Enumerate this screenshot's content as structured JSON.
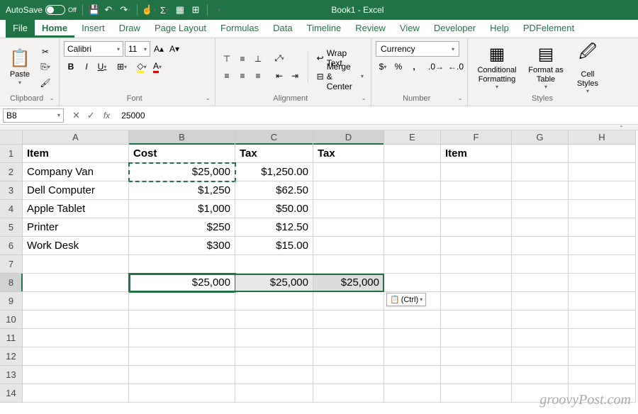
{
  "titlebar": {
    "autosave_label": "AutoSave",
    "autosave_state": "Off",
    "title": "Book1 - Excel"
  },
  "tabs": [
    "File",
    "Home",
    "Insert",
    "Draw",
    "Page Layout",
    "Formulas",
    "Data",
    "Timeline",
    "Review",
    "View",
    "Developer",
    "Help",
    "PDFelement"
  ],
  "ribbon": {
    "clipboard": {
      "paste": "Paste",
      "label": "Clipboard"
    },
    "font": {
      "name": "Calibri",
      "size": "11",
      "bold": "B",
      "italic": "I",
      "underline": "U",
      "label": "Font"
    },
    "alignment": {
      "wrap": "Wrap Text",
      "merge": "Merge & Center",
      "label": "Alignment"
    },
    "number": {
      "format": "Currency",
      "label": "Number"
    },
    "styles": {
      "cond": "Conditional Formatting",
      "fmt_table": "Format as Table",
      "cell": "Cell Styles",
      "label": "Styles"
    }
  },
  "formula_bar": {
    "name_box": "B8",
    "fx": "fx",
    "value": "25000"
  },
  "columns": [
    "A",
    "B",
    "C",
    "D",
    "E",
    "F",
    "G",
    "H"
  ],
  "rows": [
    "1",
    "2",
    "3",
    "4",
    "5",
    "6",
    "7",
    "8",
    "9",
    "10",
    "11",
    "12",
    "13",
    "14"
  ],
  "data": {
    "headers": {
      "A1": "Item",
      "B1": "Cost",
      "C1": "Tax",
      "D1": "Tax",
      "F1": "Item"
    },
    "items": [
      {
        "name": "Company Van",
        "cost": "$25,000",
        "tax": "$1,250.00"
      },
      {
        "name": "Dell Computer",
        "cost": "$1,250",
        "tax": "$62.50"
      },
      {
        "name": "Apple Tablet",
        "cost": "$1,000",
        "tax": "$50.00"
      },
      {
        "name": "Printer",
        "cost": "$250",
        "tax": "$12.50"
      },
      {
        "name": "Work Desk",
        "cost": "$300",
        "tax": "$15.00"
      }
    ],
    "paste_row": {
      "B8": "$25,000",
      "C8": "$25,000",
      "D8": "$25,000"
    }
  },
  "paste_options": "(Ctrl)",
  "watermark": "groovyPost.com"
}
